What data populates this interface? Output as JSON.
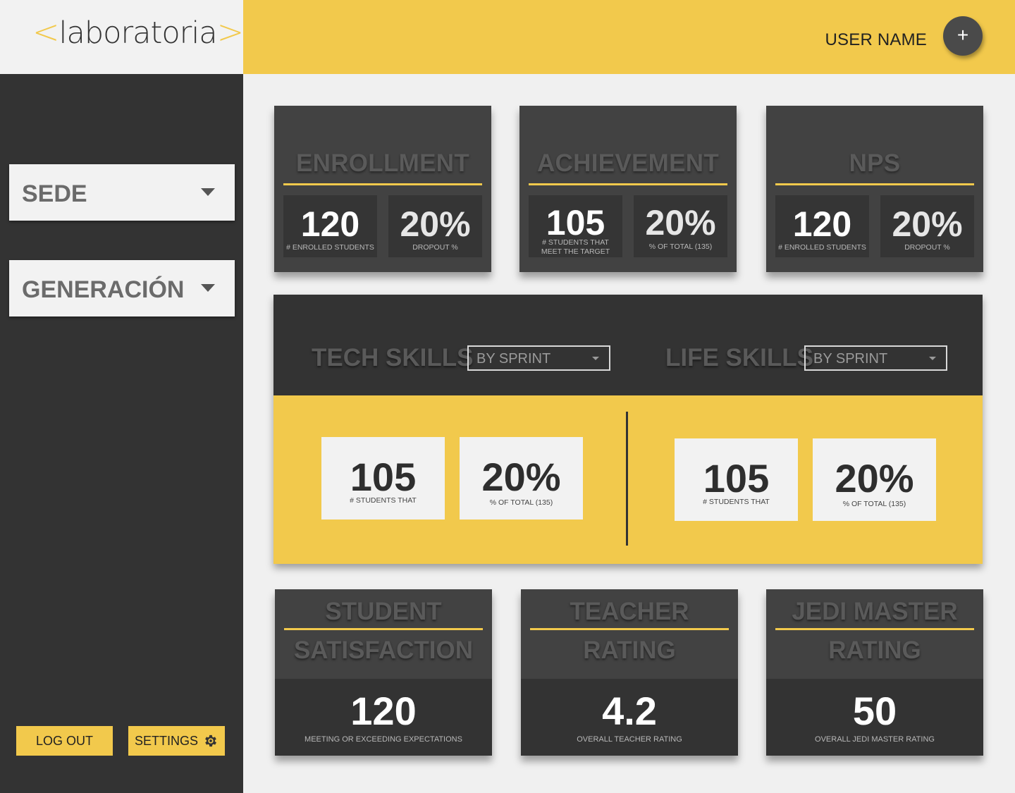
{
  "logo": {
    "open": "<",
    "word": "laboratoria",
    "close": ">"
  },
  "header": {
    "user_name": "USER NAME",
    "add_button": "+"
  },
  "sidebar": {
    "sede": "SEDE",
    "generacion": "GENERACIÓN",
    "logout": "LOG OUT",
    "settings": "SETTINGS"
  },
  "enrollment": {
    "title": "ENROLLMENT",
    "stat1": {
      "value": "120",
      "label": "# ENROLLED STUDENTS"
    },
    "stat2": {
      "value": "20%",
      "label": "DROPOUT %"
    }
  },
  "achievement": {
    "title": "ACHIEVEMENT",
    "stat1": {
      "value": "105",
      "label_line1": "# STUDENTS THAT",
      "label_line2": "MEET THE TARGET"
    },
    "stat2": {
      "value": "20%",
      "label": "% OF TOTAL (135)"
    }
  },
  "nps": {
    "title": "NPS",
    "stat1": {
      "value": "120",
      "label": "# ENROLLED STUDENTS"
    },
    "stat2": {
      "value": "20%",
      "label": "DROPOUT %"
    }
  },
  "skills": {
    "tech": {
      "title": "TECH SKILLS",
      "filter": "BY SPRINT",
      "stat1": {
        "value": "105",
        "label": "# STUDENTS THAT"
      },
      "stat2": {
        "value": "20%",
        "label": "% OF TOTAL (135)"
      }
    },
    "life": {
      "title": "LIFE SKILLS",
      "filter": "BY SPRINT",
      "stat1": {
        "value": "105",
        "label": "# STUDENTS THAT"
      },
      "stat2": {
        "value": "20%",
        "label": "% OF TOTAL (135)"
      }
    }
  },
  "student_satisfaction": {
    "title_line1": "STUDENT",
    "title_line2": "SATISFACTION",
    "value": "120",
    "label": "MEETING OR EXCEEDING EXPECTATIONS"
  },
  "teacher_rating": {
    "title_line1": "TEACHER",
    "title_line2": "RATING",
    "value": "4.2",
    "label": "OVERALL TEACHER RATING"
  },
  "jedi_master_rating": {
    "title_line1": "JEDI MASTER",
    "title_line2": "RATING",
    "value": "50",
    "label": "OVERALL JEDI MASTER RATING"
  },
  "colors": {
    "accent": "#f2c94c",
    "dark": "#333333",
    "card": "#424242",
    "light": "#f2f2f2"
  }
}
